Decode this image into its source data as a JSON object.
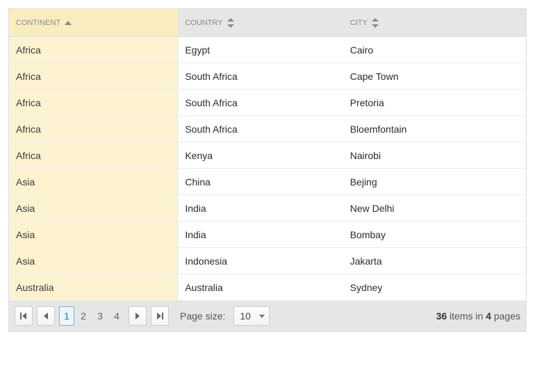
{
  "columns": {
    "continent": {
      "label": "Continent",
      "sort": "asc"
    },
    "country": {
      "label": "Country",
      "sort": "none"
    },
    "city": {
      "label": "City",
      "sort": "none"
    }
  },
  "rows": [
    {
      "continent": "Africa",
      "country": "Egypt",
      "city": "Cairo"
    },
    {
      "continent": "Africa",
      "country": "South Africa",
      "city": "Cape Town"
    },
    {
      "continent": "Africa",
      "country": "South Africa",
      "city": "Pretoria"
    },
    {
      "continent": "Africa",
      "country": "South Africa",
      "city": "Bloemfontain"
    },
    {
      "continent": "Africa",
      "country": "Kenya",
      "city": "Nairobi"
    },
    {
      "continent": "Asia",
      "country": "China",
      "city": "Bejing"
    },
    {
      "continent": "Asia",
      "country": "India",
      "city": "New Delhi"
    },
    {
      "continent": "Asia",
      "country": "India",
      "city": "Bombay"
    },
    {
      "continent": "Asia",
      "country": "Indonesia",
      "city": "Jakarta"
    },
    {
      "continent": "Australia",
      "country": "Australia",
      "city": "Sydney"
    }
  ],
  "pager": {
    "pages": [
      "1",
      "2",
      "3",
      "4"
    ],
    "current": "1",
    "page_size_label": "Page size:",
    "page_size_value": "10",
    "total_items": "36",
    "items_in_text": " items in ",
    "total_pages": "4",
    "pages_text": " pages"
  }
}
